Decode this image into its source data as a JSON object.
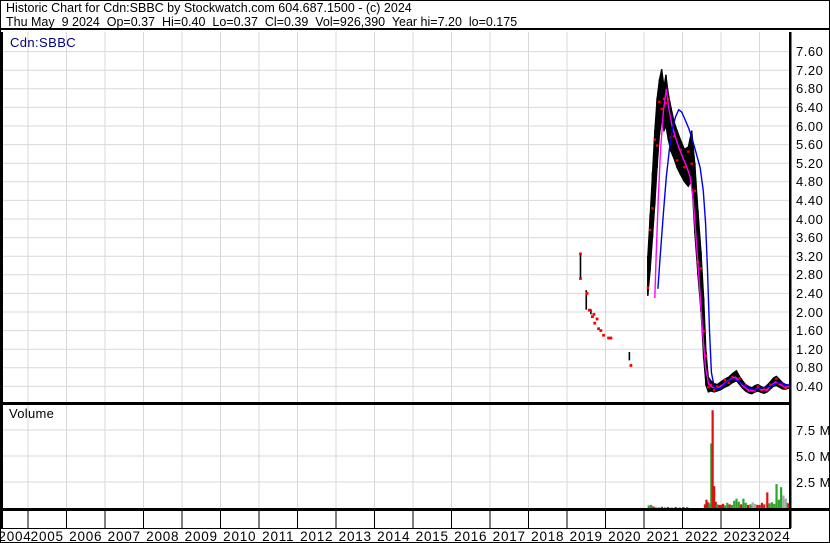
{
  "header": {
    "title_line": "Historic Chart for Cdn:SBBC by Stockwatch.com 604.687.1500 - (c) 2024",
    "quote_line": "Thu May  9 2024  Op=0.37  Hi=0.40  Lo=0.37  Cl=0.39  Vol=926,390  Year hi=7.20  lo=0.175"
  },
  "price_panel": {
    "symbol": "Cdn:SBBC"
  },
  "volume_panel": {
    "label": "Volume"
  },
  "colors": {
    "grid": "#d9d9d9",
    "border": "#000000",
    "price_bars": "#000000",
    "close_dots": "#ff0000",
    "fast_ma": "#ff00ff",
    "slow_ma": "#0000ee",
    "vol_up": "#2ba52b",
    "vol_down": "#dd1111",
    "vol_neutral": "#a9a9a9",
    "symbol_text": "#000080"
  },
  "chart_data": [
    {
      "type": "line",
      "title": "Cdn:SBBC historic price",
      "xlim": [
        2004.3,
        2024.78
      ],
      "ylim": [
        0,
        8.0
      ],
      "grid": true,
      "y_axis_position": "right",
      "price_tick_values": [
        7.6,
        7.2,
        6.8,
        6.4,
        6.0,
        5.6,
        5.2,
        4.8,
        4.4,
        4.0,
        3.6,
        3.2,
        2.8,
        2.4,
        2.0,
        1.6,
        1.2,
        0.8,
        0.4
      ],
      "price_tick_labels": [
        "7.60",
        "7.20",
        "6.80",
        "6.40",
        "6.00",
        "5.60",
        "5.20",
        "4.80",
        "4.40",
        "4.00",
        "3.60",
        "3.20",
        "2.80",
        "2.40",
        "2.00",
        "1.60",
        "1.20",
        "0.80",
        "0.40"
      ],
      "year_labels": [
        "2004",
        "2005",
        "2006",
        "2007",
        "2008",
        "2009",
        "2010",
        "2011",
        "2012",
        "2013",
        "2014",
        "2015",
        "2016",
        "2017",
        "2018",
        "2019",
        "2020",
        "2021",
        "2022",
        "2023",
        "2024"
      ],
      "series": [
        {
          "name": "early-trade-bars",
          "legend": "sparse high-low bars 2019-2020",
          "points_yhl": [
            [
              2019.35,
              3.25,
              2.72
            ],
            [
              2019.5,
              2.47,
              2.05
            ],
            [
              2019.62,
              2.06,
              1.95
            ],
            [
              2020.62,
              1.14,
              0.96
            ]
          ]
        },
        {
          "name": "early-trade-closes",
          "legend": "sparse close dots 2019-2020",
          "points_xy": [
            [
              2019.35,
              3.25
            ],
            [
              2019.35,
              2.72
            ],
            [
              2019.52,
              2.4
            ],
            [
              2019.58,
              2.04
            ],
            [
              2019.66,
              1.9
            ],
            [
              2019.7,
              1.95
            ],
            [
              2019.72,
              1.76
            ],
            [
              2019.78,
              1.85
            ],
            [
              2019.82,
              1.64
            ],
            [
              2019.88,
              1.6
            ],
            [
              2019.95,
              1.5
            ],
            [
              2020.08,
              1.44
            ],
            [
              2020.14,
              1.44
            ],
            [
              2020.66,
              0.85
            ]
          ]
        },
        {
          "name": "price-range",
          "legend": "daily high-low band (black)",
          "points_yhl": [
            [
              2021.1,
              3.2,
              2.35
            ],
            [
              2021.16,
              4.1,
              2.9
            ],
            [
              2021.22,
              5.0,
              3.6
            ],
            [
              2021.28,
              5.9,
              4.3
            ],
            [
              2021.34,
              6.6,
              5.1
            ],
            [
              2021.4,
              7.0,
              5.8
            ],
            [
              2021.46,
              7.22,
              6.15
            ],
            [
              2021.52,
              6.85,
              5.9
            ],
            [
              2021.57,
              7.1,
              6.0
            ],
            [
              2021.63,
              6.7,
              5.7
            ],
            [
              2021.7,
              6.4,
              5.45
            ],
            [
              2021.78,
              6.1,
              5.3
            ],
            [
              2021.86,
              5.9,
              5.1
            ],
            [
              2021.95,
              5.7,
              4.95
            ],
            [
              2022.05,
              5.5,
              4.8
            ],
            [
              2022.15,
              5.55,
              4.7
            ],
            [
              2022.24,
              5.9,
              4.85
            ],
            [
              2022.32,
              5.2,
              3.7
            ],
            [
              2022.4,
              4.2,
              2.8
            ],
            [
              2022.48,
              3.3,
              2.0
            ],
            [
              2022.55,
              2.3,
              1.0
            ],
            [
              2022.61,
              1.15,
              0.42
            ],
            [
              2022.67,
              0.6,
              0.28
            ],
            [
              2022.74,
              0.52,
              0.3
            ],
            [
              2022.82,
              0.46,
              0.28
            ],
            [
              2022.9,
              0.44,
              0.3
            ],
            [
              2023.0,
              0.5,
              0.33
            ],
            [
              2023.1,
              0.56,
              0.38
            ],
            [
              2023.2,
              0.6,
              0.42
            ],
            [
              2023.3,
              0.68,
              0.48
            ],
            [
              2023.4,
              0.74,
              0.52
            ],
            [
              2023.48,
              0.62,
              0.44
            ],
            [
              2023.56,
              0.52,
              0.36
            ],
            [
              2023.64,
              0.44,
              0.3
            ],
            [
              2023.72,
              0.4,
              0.26
            ],
            [
              2023.8,
              0.37,
              0.24
            ],
            [
              2023.88,
              0.42,
              0.28
            ],
            [
              2023.96,
              0.44,
              0.3
            ],
            [
              2024.04,
              0.4,
              0.27
            ],
            [
              2024.12,
              0.37,
              0.25
            ],
            [
              2024.2,
              0.43,
              0.28
            ],
            [
              2024.28,
              0.5,
              0.34
            ],
            [
              2024.36,
              0.58,
              0.4
            ],
            [
              2024.44,
              0.62,
              0.42
            ],
            [
              2024.52,
              0.55,
              0.38
            ],
            [
              2024.6,
              0.48,
              0.34
            ],
            [
              2024.68,
              0.44,
              0.34
            ],
            [
              2024.76,
              0.42,
              0.36
            ]
          ]
        },
        {
          "name": "fast-ma",
          "legend": "fast moving average (magenta)",
          "points_xy": [
            [
              2021.28,
              2.3
            ],
            [
              2021.32,
              3.3
            ],
            [
              2021.37,
              4.4
            ],
            [
              2021.43,
              5.5
            ],
            [
              2021.5,
              6.3
            ],
            [
              2021.58,
              6.8
            ],
            [
              2021.65,
              6.35
            ],
            [
              2021.73,
              6.0
            ],
            [
              2021.82,
              5.75
            ],
            [
              2021.92,
              5.5
            ],
            [
              2022.02,
              5.3
            ],
            [
              2022.12,
              5.1
            ],
            [
              2022.2,
              4.9
            ],
            [
              2022.28,
              4.4
            ],
            [
              2022.36,
              3.5
            ],
            [
              2022.44,
              2.6
            ],
            [
              2022.52,
              1.6
            ],
            [
              2022.6,
              0.8
            ],
            [
              2022.68,
              0.45
            ],
            [
              2022.78,
              0.38
            ],
            [
              2022.9,
              0.36
            ],
            [
              2023.02,
              0.42
            ],
            [
              2023.14,
              0.5
            ],
            [
              2023.26,
              0.56
            ],
            [
              2023.38,
              0.6
            ],
            [
              2023.48,
              0.5
            ],
            [
              2023.58,
              0.4
            ],
            [
              2023.7,
              0.33
            ],
            [
              2023.82,
              0.3
            ],
            [
              2023.94,
              0.36
            ],
            [
              2024.06,
              0.33
            ],
            [
              2024.18,
              0.32
            ],
            [
              2024.3,
              0.42
            ],
            [
              2024.42,
              0.5
            ],
            [
              2024.54,
              0.44
            ],
            [
              2024.66,
              0.38
            ],
            [
              2024.76,
              0.4
            ]
          ]
        },
        {
          "name": "slow-ma",
          "legend": "slow moving average (blue)",
          "points_xy": [
            [
              2021.36,
              2.5
            ],
            [
              2021.42,
              3.2
            ],
            [
              2021.5,
              4.1
            ],
            [
              2021.58,
              4.9
            ],
            [
              2021.66,
              5.5
            ],
            [
              2021.74,
              5.95
            ],
            [
              2021.82,
              6.2
            ],
            [
              2021.9,
              6.35
            ],
            [
              2021.98,
              6.3
            ],
            [
              2022.06,
              6.15
            ],
            [
              2022.16,
              5.95
            ],
            [
              2022.26,
              5.7
            ],
            [
              2022.36,
              5.4
            ],
            [
              2022.46,
              5.1
            ],
            [
              2022.54,
              4.6
            ],
            [
              2022.6,
              3.9
            ],
            [
              2022.65,
              2.9
            ],
            [
              2022.7,
              1.6
            ],
            [
              2022.75,
              0.7
            ],
            [
              2022.82,
              0.4
            ],
            [
              2022.92,
              0.34
            ],
            [
              2023.04,
              0.4
            ],
            [
              2023.16,
              0.5
            ],
            [
              2023.3,
              0.56
            ],
            [
              2023.44,
              0.52
            ],
            [
              2023.58,
              0.44
            ],
            [
              2023.72,
              0.37
            ],
            [
              2023.86,
              0.33
            ],
            [
              2024.0,
              0.35
            ],
            [
              2024.14,
              0.38
            ],
            [
              2024.28,
              0.4
            ],
            [
              2024.42,
              0.46
            ],
            [
              2024.56,
              0.48
            ],
            [
              2024.68,
              0.43
            ],
            [
              2024.76,
              0.44
            ]
          ]
        }
      ]
    },
    {
      "type": "bar",
      "title": "Volume",
      "ylim": [
        0,
        9.9
      ],
      "ytick_values": [
        7.5,
        5.0,
        2.5
      ],
      "ytick_labels": [
        "7.5 M",
        "5.0 M",
        "2.5 M"
      ],
      "unit": "millions of shares",
      "bars": [
        [
          2021.12,
          0.25,
          "up"
        ],
        [
          2021.18,
          0.3,
          "up"
        ],
        [
          2021.24,
          0.15,
          "down"
        ],
        [
          2021.3,
          0.12,
          "neutral"
        ],
        [
          2021.38,
          0.1,
          "neutral"
        ],
        [
          2021.46,
          0.12,
          "down"
        ],
        [
          2021.54,
          0.1,
          "neutral"
        ],
        [
          2021.62,
          0.1,
          "down"
        ],
        [
          2021.72,
          0.08,
          "neutral"
        ],
        [
          2021.82,
          0.1,
          "down"
        ],
        [
          2021.92,
          0.08,
          "neutral"
        ],
        [
          2022.02,
          0.1,
          "down"
        ],
        [
          2022.12,
          0.08,
          "down"
        ],
        [
          2022.58,
          0.35,
          "down"
        ],
        [
          2022.62,
          0.8,
          "down"
        ],
        [
          2022.66,
          0.55,
          "down"
        ],
        [
          2022.7,
          0.45,
          "up"
        ],
        [
          2022.745,
          6.2,
          "up"
        ],
        [
          2022.78,
          9.4,
          "down"
        ],
        [
          2022.82,
          2.1,
          "down"
        ],
        [
          2022.86,
          0.6,
          "down"
        ],
        [
          2022.9,
          0.35,
          "up"
        ],
        [
          2022.95,
          0.3,
          "down"
        ],
        [
          2023.0,
          0.3,
          "down"
        ],
        [
          2023.05,
          0.4,
          "down"
        ],
        [
          2023.1,
          0.25,
          "up"
        ],
        [
          2023.16,
          0.5,
          "up"
        ],
        [
          2023.22,
          0.35,
          "down"
        ],
        [
          2023.28,
          0.3,
          "up"
        ],
        [
          2023.34,
          0.7,
          "up"
        ],
        [
          2023.4,
          0.9,
          "up"
        ],
        [
          2023.46,
          0.6,
          "up"
        ],
        [
          2023.52,
          0.35,
          "down"
        ],
        [
          2023.58,
          0.9,
          "up"
        ],
        [
          2023.64,
          0.5,
          "up"
        ],
        [
          2023.7,
          0.3,
          "down"
        ],
        [
          2023.76,
          0.35,
          "up"
        ],
        [
          2023.82,
          0.55,
          "neutral"
        ],
        [
          2023.88,
          0.4,
          "neutral"
        ],
        [
          2023.94,
          0.3,
          "down"
        ],
        [
          2024.0,
          0.3,
          "down"
        ],
        [
          2024.06,
          0.5,
          "down"
        ],
        [
          2024.12,
          0.35,
          "down"
        ],
        [
          2024.2,
          1.5,
          "down"
        ],
        [
          2024.26,
          0.45,
          "up"
        ],
        [
          2024.32,
          0.55,
          "up"
        ],
        [
          2024.38,
          0.4,
          "up"
        ],
        [
          2024.44,
          2.3,
          "up"
        ],
        [
          2024.5,
          0.8,
          "up"
        ],
        [
          2024.56,
          2.0,
          "up"
        ],
        [
          2024.62,
          1.2,
          "neutral"
        ],
        [
          2024.68,
          0.9,
          "neutral"
        ],
        [
          2024.73,
          0.5,
          "up"
        ],
        [
          2024.76,
          0.4,
          "down"
        ]
      ]
    }
  ]
}
